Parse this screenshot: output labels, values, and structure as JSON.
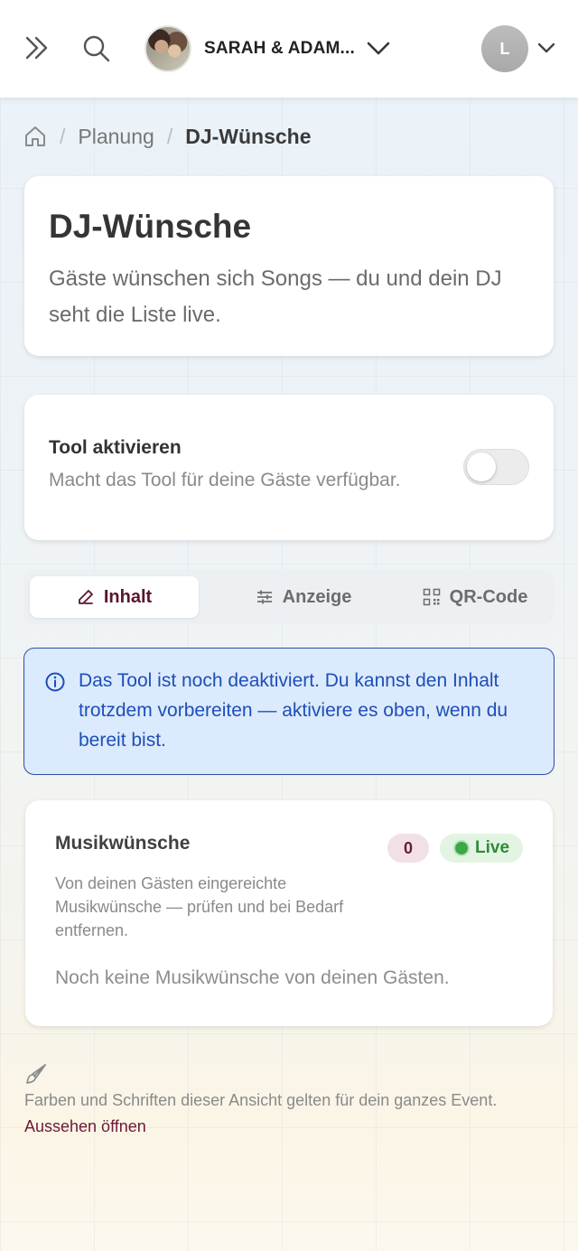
{
  "header": {
    "expand_icon": "chevrons-right-icon",
    "search_icon": "search-icon",
    "event_name": "SARAH & ADAM...",
    "user_initial": "L"
  },
  "breadcrumb": {
    "home_icon": "home-icon",
    "items": [
      "Planung",
      "DJ-Wünsche"
    ]
  },
  "page": {
    "title": "DJ-Wünsche",
    "description": "Gäste wünschen sich Songs — du und dein DJ seht die Liste live."
  },
  "toggle": {
    "title": "Tool aktivieren",
    "description": "Macht das Tool für deine Gäste verfügbar.",
    "enabled": false
  },
  "tabs": [
    {
      "label": "Inhalt",
      "icon": "edit-icon",
      "active": true
    },
    {
      "label": "Anzeige",
      "icon": "sliders-icon",
      "active": false
    },
    {
      "label": "QR-Code",
      "icon": "qr-code-icon",
      "active": false
    }
  ],
  "info": {
    "icon": "info-icon",
    "text": "Das Tool ist noch deaktiviert. Du kannst den Inhalt trotzdem vorbereiten — aktiviere es oben, wenn du bereit bist."
  },
  "wishes": {
    "title": "Musikwünsche",
    "count": "0",
    "live_label": "Live",
    "description": "Von deinen Gästen eingereichte Musikwünsche — prüfen und bei Bedarf entfernen.",
    "empty_text": "Noch keine Musikwünsche von deinen Gästen."
  },
  "footer": {
    "icon": "paintbrush-icon",
    "note": "Farben und Schriften dieser Ansicht gelten für dein ganzes Event.",
    "link": "Aussehen öffnen"
  },
  "colors": {
    "accent": "#6b1a36",
    "info_bg": "#dceafd",
    "info_text": "#1d4fb8",
    "live_green": "#3aa845"
  }
}
